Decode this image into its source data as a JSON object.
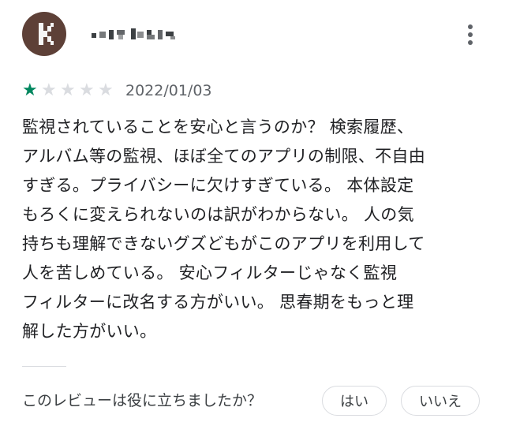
{
  "review": {
    "author": {
      "name_obscured": true,
      "avatar_letter": "K"
    },
    "rating": 1,
    "rating_max": 5,
    "date": "2022/01/03",
    "text": "監視されていることを安心と言うのか？ 検索履歴、\nアルバム等の監視、ほぼ全てのアプリの制限、不自由\nすぎる。プライバシーに欠けすぎている。 本体設定\nもろくに変えられないのは訳がわからない。 人の気\n持ちも理解できないグズどもがこのアプリを利用して\n人を苦しめている。 安心フィルターじゃなく監視\nフィルターに改名する方がいい。 思春期をもっと理\n解した方がいい。"
  },
  "feedback": {
    "question": "このレビューは役に立ちましたか？",
    "yes_label": "はい",
    "no_label": "いいえ"
  },
  "colors": {
    "star_filled": "#01875f",
    "star_empty": "#dadce0",
    "avatar_bg": "#5d4037"
  },
  "icons": {
    "menu": "more-vert-icon",
    "star": "star-icon"
  }
}
